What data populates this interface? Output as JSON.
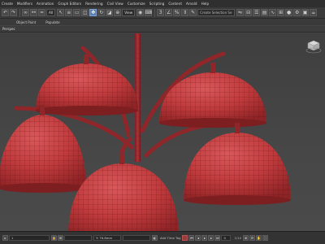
{
  "menubar": {
    "items": [
      "Create",
      "Modifiers",
      "Animation",
      "Graph Editors",
      "Rendering",
      "Civil View",
      "Customize",
      "Scripting",
      "Content",
      "Arnold",
      "Help"
    ]
  },
  "toolbar": {
    "selection_filter": "All",
    "view_dropdown": "View",
    "named_selection_placeholder": "Create Selection Se"
  },
  "ribbon": {
    "tabs": [
      "Object Paint",
      "Populate"
    ]
  },
  "viewport": {
    "label": "Perspec",
    "mesh_color": "#c33d3f",
    "wire_color": "#5a1113"
  },
  "statusbar": {
    "selection_info": "1",
    "x_value": "",
    "y_value": "Y: 76.8mm",
    "auto_key": "",
    "set_key": "Add Time Tag",
    "frame": "0",
    "extra": "1/10"
  }
}
